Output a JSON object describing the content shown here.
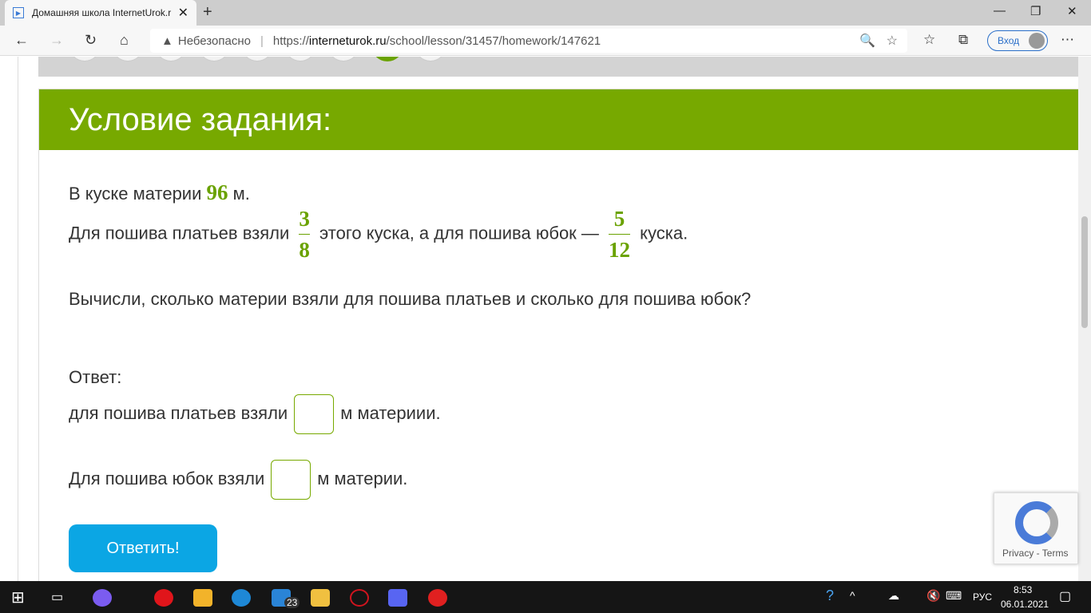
{
  "browser": {
    "tab_title": "Домашняя школа InternetUrok.ru",
    "security": "Небезопасно",
    "url_prefix": "https://",
    "url_host": "interneturok.ru",
    "url_path": "/school/lesson/31457/homework/147621",
    "login": "Вход"
  },
  "task": {
    "heading": "Условие задания:",
    "line1_pre": "В куске материи ",
    "total": "96",
    "line1_post": " м.",
    "line2_pre": "Для пошива платьев взяли",
    "f1_num": "3",
    "f1_den": "8",
    "line2_mid": "этого куска, а для пошива юбок —",
    "f2_num": "5",
    "f2_den": "12",
    "line2_post": "куска.",
    "question": "Вычисли, сколько материи взяли для пошива платьев и сколько для пошива юбок?",
    "answer_label": "Ответ:",
    "a1_pre": "для пошива платьев взяли",
    "a1_post": "м материии.",
    "a2_pre": "Для пошива юбок взяли",
    "a2_post": "м материи.",
    "submit": "Ответить!"
  },
  "recaptcha": {
    "links": "Privacy - Terms"
  },
  "taskbar": {
    "mail_badge": "23",
    "lang": "РУС",
    "time": "8:53",
    "date": "06.01.2021"
  },
  "colors": {
    "accent": "#77a900",
    "button": "#0ba6e4"
  }
}
